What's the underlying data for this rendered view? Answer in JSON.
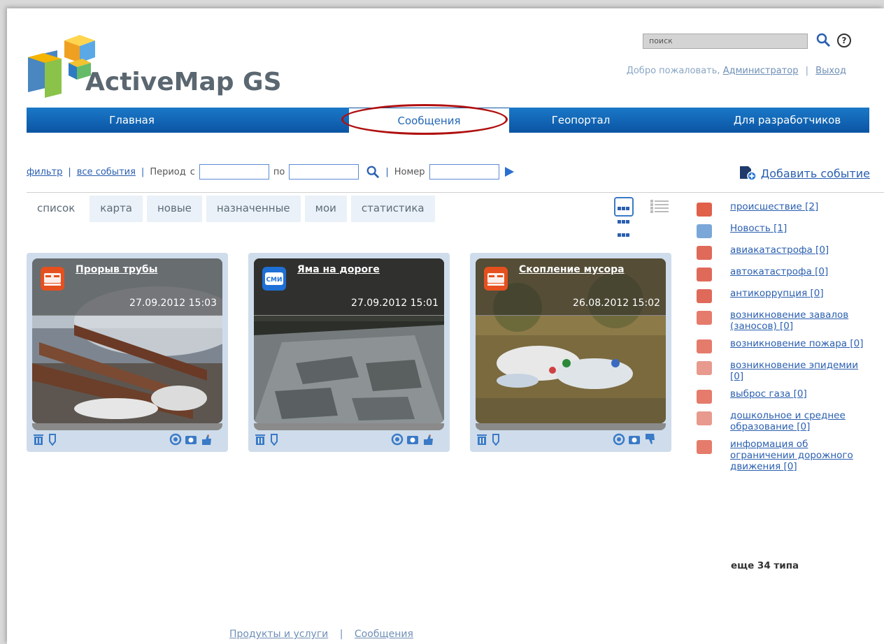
{
  "brand": {
    "name": "ActiveMap GS"
  },
  "header": {
    "search_placeholder": "поиск",
    "welcome_text": "Добро пожаловать,",
    "user": "Администратор",
    "separator": "|",
    "logout": "Выход"
  },
  "nav": {
    "items": [
      "Главная",
      "Сообщения",
      "Геопортал",
      "Для разработчиков"
    ],
    "active": "Сообщения"
  },
  "filter": {
    "filter_link": "фильтр",
    "sep": "|",
    "all_events": "все события",
    "period_label": "Период",
    "from_label": "с",
    "to_label": "по",
    "number_label": "Номер",
    "from_value": "",
    "to_value": "",
    "number_value": ""
  },
  "add_event": {
    "label": "Добавить событие"
  },
  "tabs": [
    "список",
    "карта",
    "новые",
    "назначенные",
    "мои",
    "статистика"
  ],
  "cards": [
    {
      "title": "Прорыв трубы",
      "date": "27.09.2012 15:03",
      "icon": "incident-icon",
      "color": "#e5501e"
    },
    {
      "title": "Яма на дороге",
      "date": "27.09.2012 15:01",
      "icon": "media-icon",
      "color": "#1e6fd6"
    },
    {
      "title": "Скопление мусора",
      "date": "26.08.2012 15:02",
      "icon": "incident-icon",
      "color": "#e5501e"
    }
  ],
  "categories": [
    {
      "label": "происшествие [2]",
      "color": "#e0604a"
    },
    {
      "label": "Новость [1]",
      "color": "#7aa7d8"
    },
    {
      "label": "авиакатастрофа [0]",
      "color": "#e06a5a"
    },
    {
      "label": "автокатастрофа [0]",
      "color": "#e06a5a"
    },
    {
      "label": "антикоррупция [0]",
      "color": "#e06a5a"
    },
    {
      "label": "возникновение завалов (заносов) [0]",
      "color": "#e57b6b"
    },
    {
      "label": "возникновение пожара [0]",
      "color": "#e57b6b"
    },
    {
      "label": "возникновение эпидемии [0]",
      "color": "#e89a8e"
    },
    {
      "label": "выброс газа [0]",
      "color": "#e57b6b"
    },
    {
      "label": "дошкольное и среднее образование [0]",
      "color": "#e89a8e"
    },
    {
      "label": "информация об ограничении дорожного движения [0]",
      "color": "#e57b6b"
    }
  ],
  "more_types": "еще 34 типа",
  "footer": {
    "products": "Продукты и услуги",
    "sep": "|",
    "messages": "Сообщения"
  }
}
